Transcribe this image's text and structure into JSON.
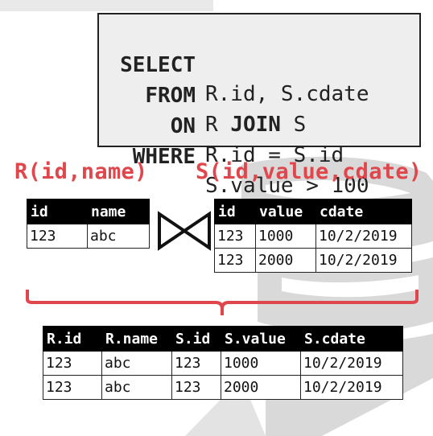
{
  "query": {
    "lines": [
      {
        "keyword": "SELECT",
        "rest": "R.id, S.cdate"
      },
      {
        "keyword": "FROM",
        "rest": "R JOIN S",
        "rest_bold": "JOIN"
      },
      {
        "keyword": "ON",
        "rest": "R.id = S.id"
      },
      {
        "keyword": "WHERE",
        "rest": "S.value > 100"
      }
    ]
  },
  "relations": {
    "r_label": "R(id,name)",
    "s_label": "S(id,value,cdate)"
  },
  "table_r": {
    "headers": [
      "id",
      "name"
    ],
    "rows": [
      [
        "123",
        "abc"
      ]
    ]
  },
  "table_s": {
    "headers": [
      "id",
      "value",
      "cdate"
    ],
    "rows": [
      [
        "123",
        "1000",
        "10/2/2019"
      ],
      [
        "123",
        "2000",
        "10/2/2019"
      ]
    ]
  },
  "table_result": {
    "headers": [
      "R.id",
      "R.name",
      "S.id",
      "S.value",
      "S.cdate"
    ],
    "rows": [
      [
        "123",
        "abc",
        "123",
        "1000",
        "10/2/2019"
      ],
      [
        "123",
        "abc",
        "123",
        "2000",
        "10/2/2019"
      ]
    ]
  },
  "icons": {
    "join": "bowtie-join-icon",
    "brace": "curly-brace-icon",
    "logo": "database-logo-watermark"
  },
  "colors": {
    "accent": "#e0474c",
    "header_bg": "#000000",
    "watermark": "#d6d6d6"
  }
}
